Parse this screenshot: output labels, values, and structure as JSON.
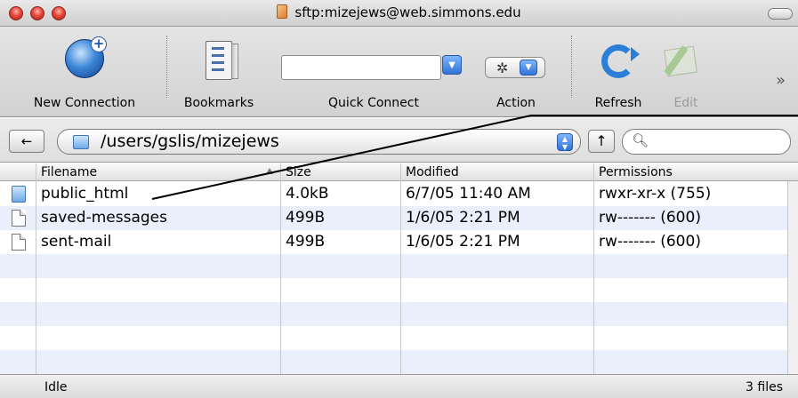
{
  "window": {
    "title": "sftp:mizejews@web.simmons.edu"
  },
  "toolbar": {
    "new_connection": "New Connection",
    "bookmarks": "Bookmarks",
    "quick_connect": "Quick Connect",
    "quick_connect_value": "",
    "action": "Action",
    "refresh": "Refresh",
    "edit": "Edit",
    "overflow": "»"
  },
  "pathbar": {
    "back_glyph": "←",
    "path": "/users/gslis/mizejews",
    "up_glyph": "↑",
    "search_value": ""
  },
  "table": {
    "columns": [
      "Filename",
      "Size",
      "Modified",
      "Permissions"
    ],
    "sorted_column": "Filename",
    "rows": [
      {
        "icon": "folder-icon",
        "name": "public_html",
        "size": "4.0kB",
        "modified": "6/7/05 11:40 AM",
        "permissions": "rwxr-xr-x (755)"
      },
      {
        "icon": "file-icon",
        "name": "saved-messages",
        "size": "499B",
        "modified": "1/6/05 2:21 PM",
        "permissions": "rw------- (600)"
      },
      {
        "icon": "file-icon",
        "name": "sent-mail",
        "size": "499B",
        "modified": "1/6/05 2:21 PM",
        "permissions": "rw------- (600)"
      }
    ]
  },
  "status": {
    "state": "Idle",
    "count": "3 files"
  },
  "colors": {
    "accent_blue": "#2f73d6",
    "row_alt": "#eaf0fb",
    "close_red": "#e8473b"
  }
}
